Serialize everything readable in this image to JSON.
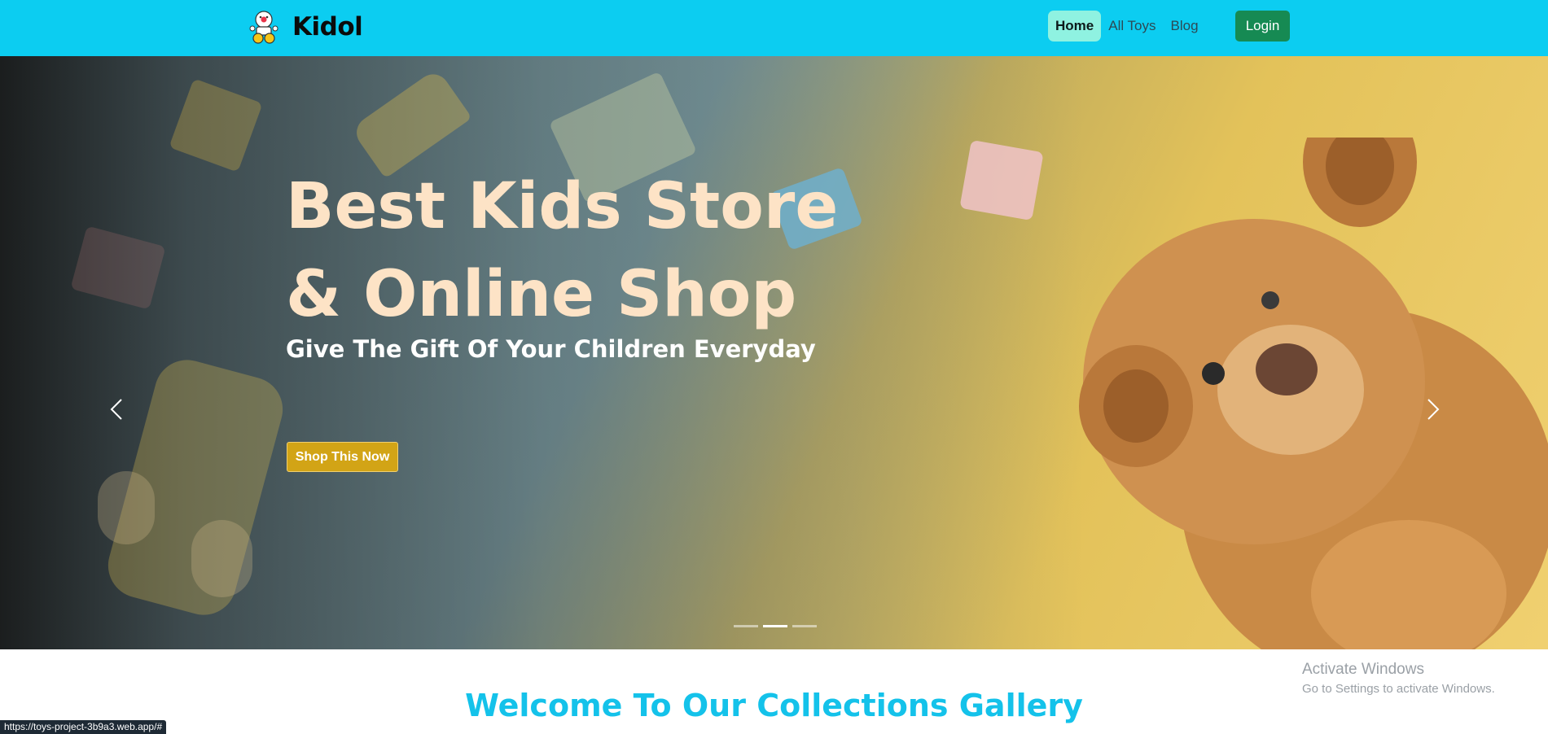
{
  "navbar": {
    "brand": "Kidol",
    "logo_icon": "toy-robot-logo-icon",
    "links": [
      {
        "label": "Home",
        "active": true
      },
      {
        "label": "All Toys",
        "active": false
      },
      {
        "label": "Blog",
        "active": false
      }
    ],
    "login_label": "Login",
    "bg_color": "#0ccdf1"
  },
  "hero": {
    "title_line1": "Best Kids Store",
    "title_line2": "& Online Shop",
    "subtitle": "Give The Gift Of Your Children Everyday",
    "cta_label": "Shop This Now",
    "prev_icon": "chevron-left-icon",
    "next_icon": "chevron-right-icon",
    "slide_count": 3,
    "active_slide": 2
  },
  "section": {
    "title": "Welcome To Our Collections Gallery"
  },
  "os_overlay": {
    "activate_title": "Activate Windows",
    "activate_subtitle": "Go to Settings to activate Windows."
  },
  "status_bar": {
    "url": "https://toys-project-3b9a3.web.app/#"
  }
}
